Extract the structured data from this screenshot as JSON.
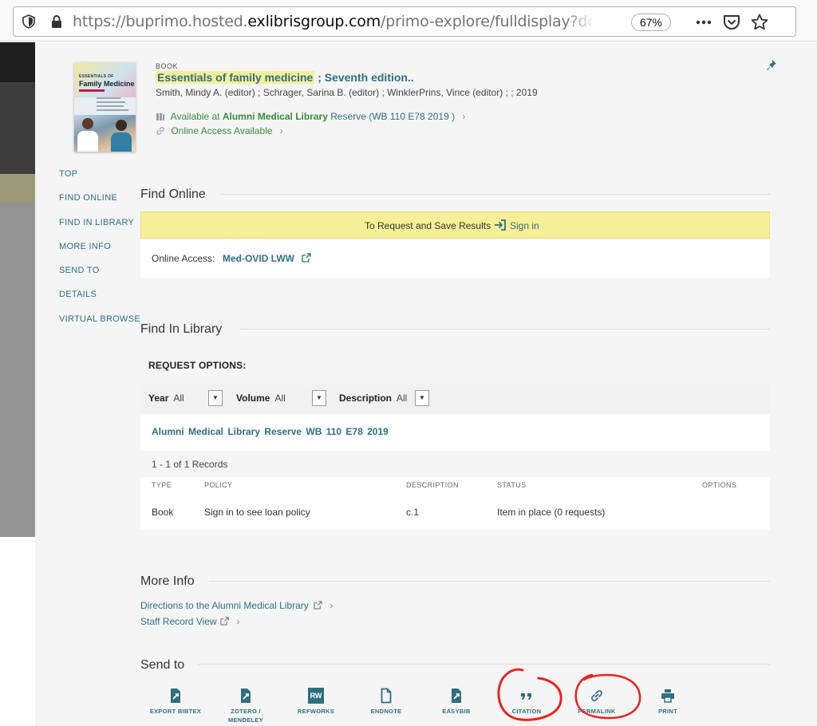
{
  "browser": {
    "url_prefix": "https://buprimo.hosted.",
    "url_domain": "exlibrisgroup.com",
    "url_rest": "/primo-explore/fulldisplay?docid=ALMA",
    "zoom": "67%"
  },
  "record": {
    "type": "BOOK",
    "title": "Essentials of family medicine",
    "edition": "; Seventh edition..",
    "authors": "Smith, Mindy A. (editor) ; Schrager, Sarina B. (editor) ; WinklerPrins, Vince (editor) ; ; 2019",
    "availability_prefix": "Available at",
    "availability_library": "Alumni Medical Library",
    "availability_location": "Reserve  (WB 110 E78 2019 )",
    "online_access": "Online Access Available",
    "cover": {
      "series": "ESSENTIALS OF",
      "title": "Family Medicine"
    }
  },
  "side_nav": [
    "TOP",
    "FIND ONLINE",
    "FIND IN LIBRARY",
    "MORE INFO",
    "SEND TO",
    "DETAILS",
    "VIRTUAL BROWSE"
  ],
  "find_online": {
    "heading": "Find Online",
    "signin_text": "To Request and Save Results",
    "signin_link": "Sign in",
    "online_label": "Online Access:",
    "online_link": "Med-OVID LWW"
  },
  "find_in_library": {
    "heading": "Find In Library",
    "request_options": "REQUEST OPTIONS:",
    "filters": [
      {
        "label": "Year",
        "value": "All"
      },
      {
        "label": "Volume",
        "value": "All"
      },
      {
        "label": "Description",
        "value": "All"
      }
    ],
    "location_line": "Alumni Medical Library  Reserve  WB 110 E78 2019",
    "record_count": "1 - 1 of 1 Records",
    "columns": [
      "TYPE",
      "POLICY",
      "DESCRIPTION",
      "STATUS",
      "OPTIONS"
    ],
    "rows": [
      {
        "type": "Book",
        "policy": "Sign in to see loan policy",
        "description": "c.1",
        "status": "Item in place (0 requests)",
        "options": ""
      }
    ]
  },
  "more_info": {
    "heading": "More Info",
    "links": [
      "Directions to the Alumni Medical Library",
      "Staff Record View"
    ]
  },
  "send_to": {
    "heading": "Send to",
    "items": [
      "EXPORT BIBTEX",
      "ZOTERO /\nMENDELEY",
      "REFWORKS",
      "ENDNOTE",
      "EASYBIB",
      "CITATION",
      "PERMALINK",
      "PRINT"
    ],
    "refworks_badge": "RW"
  },
  "colors": {
    "link": "#2f6f7f",
    "available": "#3c8a3c",
    "highlight": "#f4ef9a",
    "annotation": "#e8231f"
  }
}
